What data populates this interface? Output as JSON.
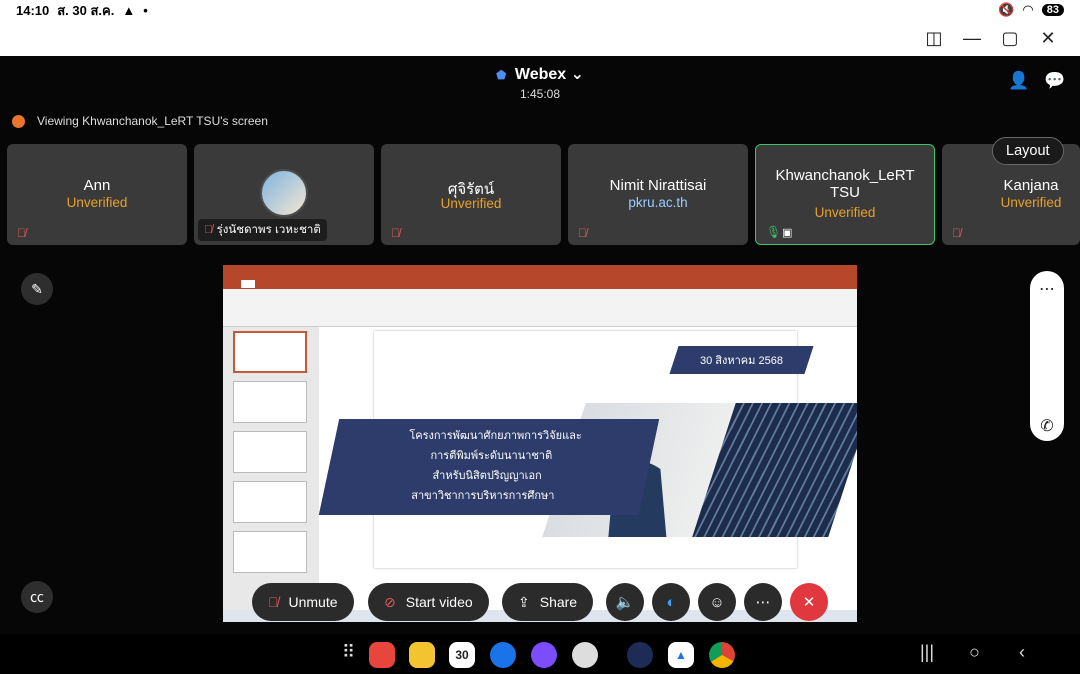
{
  "statusbar": {
    "time": "14:10",
    "date": "ส. 30 ส.ค.",
    "battery": "83"
  },
  "app": {
    "title": "Webex",
    "timer": "1:45:08",
    "viewing_text": "Viewing Khwanchanok_LeRT TSU's screen",
    "layout_label": "Layout"
  },
  "participants": [
    {
      "name": "Ann",
      "status": "Unverified"
    },
    {
      "name": "รุ่งนัชดาพร เวหะชาติ"
    },
    {
      "name": "ศุจิรัตน์",
      "status": "Unverified"
    },
    {
      "name": "Nimit Nirattisai",
      "status": "pkru.ac.th"
    },
    {
      "name": "Khwanchanok_LeRT TSU",
      "status": "Unverified"
    },
    {
      "name": "Kanjana",
      "status": "Unverified"
    }
  ],
  "slide": {
    "date": "30 สิงหาคม 2568",
    "lines": [
      "โครงการพัฒนาศักยภาพการวิจัยและ",
      "การตีพิมพ์ระดับนานาชาติ",
      "สำหรับนิสิตปริญญาเอก",
      "สาขาวิชาการบริหารการศึกษา"
    ]
  },
  "controls": {
    "unmute": "Unmute",
    "start_video": "Start video",
    "share": "Share"
  },
  "dock": {
    "calendar_day": "30"
  },
  "colors": {
    "unverified": "#e6a12a",
    "end_call": "#e0383e",
    "slide_navy": "#2d3c6a"
  }
}
